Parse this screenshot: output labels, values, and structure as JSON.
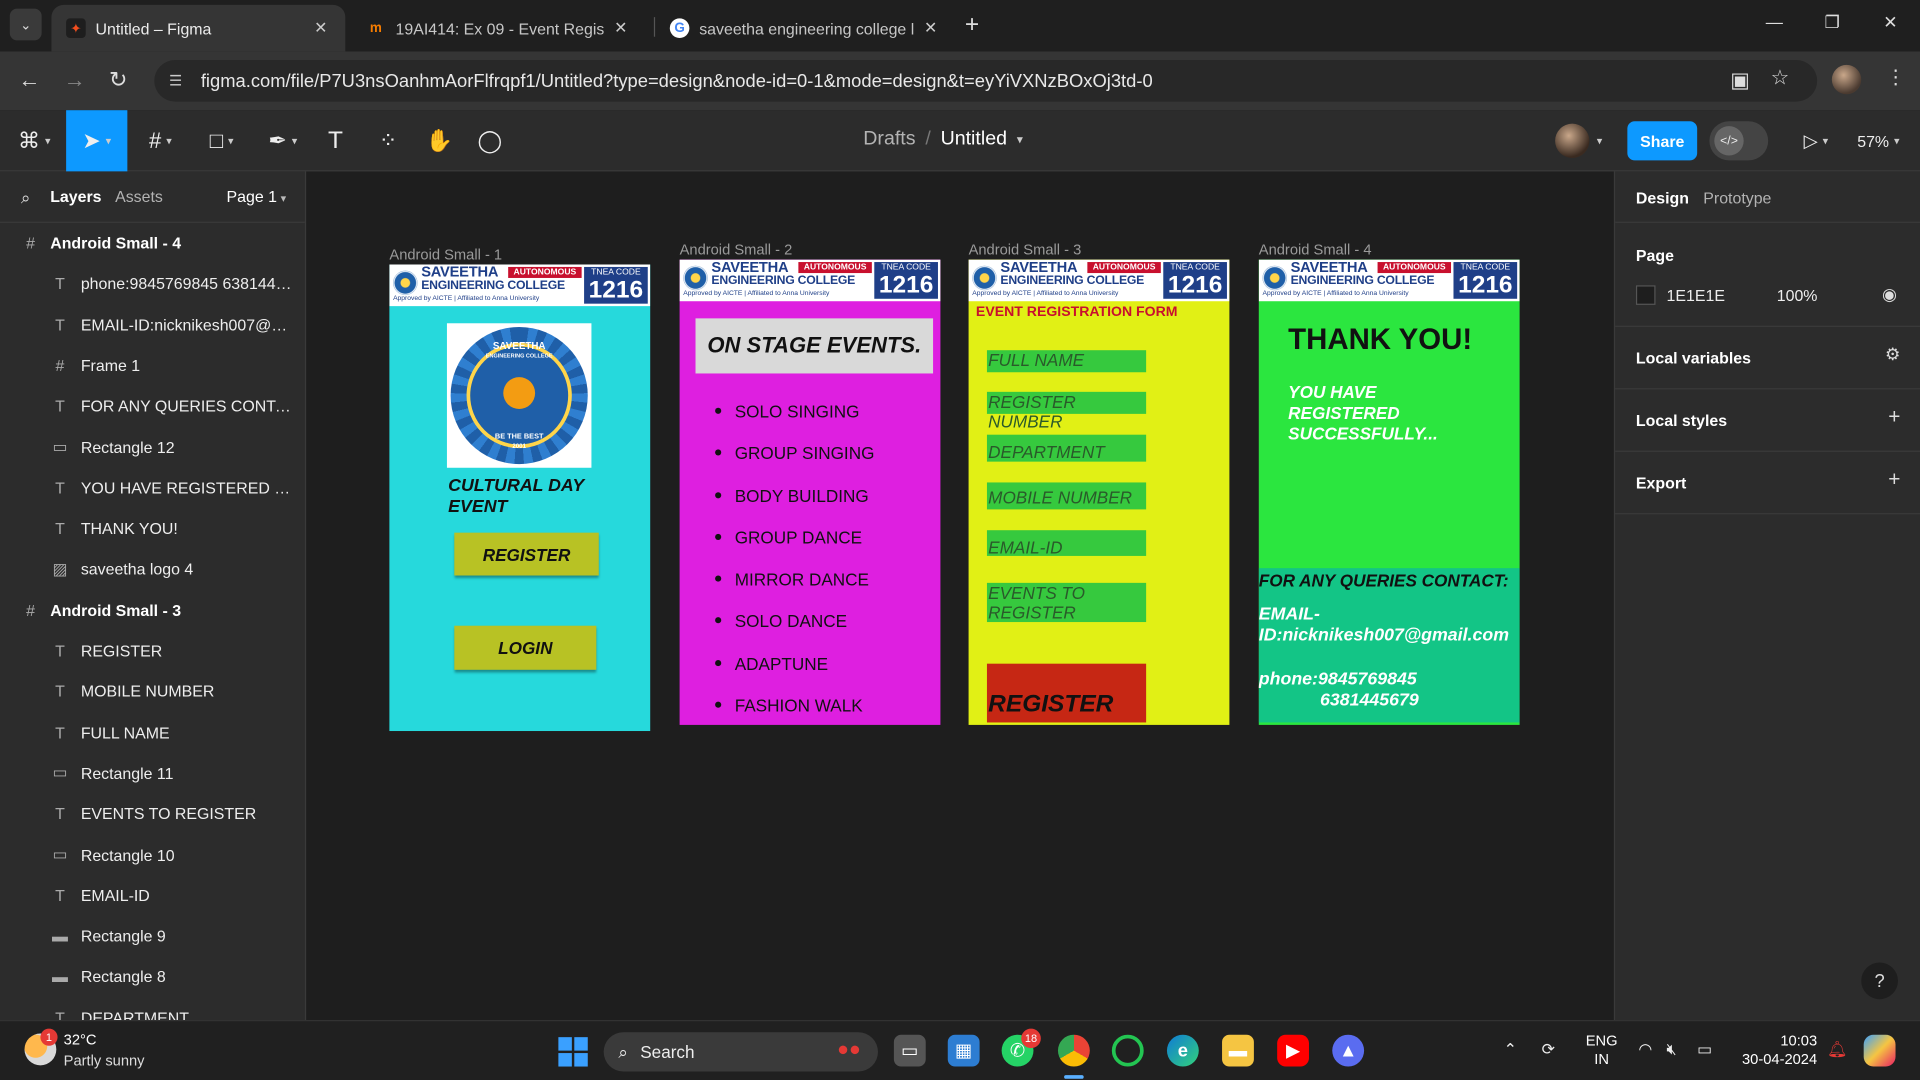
{
  "browser": {
    "tabs": [
      {
        "title": "Untitled – Figma",
        "active": true
      },
      {
        "title": "19AI414: Ex 09 - Event Registrat",
        "active": false
      },
      {
        "title": "saveetha engineering college lo",
        "active": false
      }
    ],
    "url": "figma.com/file/P7U3nsOanhmAorFlfrqpf1/Untitled?type=design&node-id=0-1&mode=design&t=eyYiVXNzBOxOj3td-0"
  },
  "figma": {
    "breadcrumb": {
      "folder": "Drafts",
      "file": "Untitled"
    },
    "share_label": "Share",
    "zoom": "57%",
    "left_panel": {
      "tab_layers": "Layers",
      "tab_assets": "Assets",
      "page": "Page 1",
      "layers": [
        {
          "name": "Android Small - 4",
          "type": "frame",
          "indent": 0
        },
        {
          "name": "phone:9845769845 6381445...",
          "type": "text",
          "indent": 1
        },
        {
          "name": "EMAIL-ID:nicknikesh007@gm...",
          "type": "text",
          "indent": 1
        },
        {
          "name": "Frame 1",
          "type": "frame-child",
          "indent": 1
        },
        {
          "name": "FOR ANY QUERIES CONTACT:",
          "type": "text",
          "indent": 1
        },
        {
          "name": "Rectangle 12",
          "type": "rect",
          "indent": 1
        },
        {
          "name": "YOU HAVE REGISTERED SUC...",
          "type": "text",
          "indent": 1
        },
        {
          "name": "THANK YOU!",
          "type": "text",
          "indent": 1
        },
        {
          "name": "saveetha logo 4",
          "type": "image",
          "indent": 1
        },
        {
          "name": "Android Small - 3",
          "type": "frame",
          "indent": 0
        },
        {
          "name": "REGISTER",
          "type": "text",
          "indent": 1
        },
        {
          "name": "MOBILE NUMBER",
          "type": "text",
          "indent": 1
        },
        {
          "name": "FULL NAME",
          "type": "text",
          "indent": 1
        },
        {
          "name": "Rectangle 11",
          "type": "rect-thin",
          "indent": 1
        },
        {
          "name": "EVENTS TO REGISTER",
          "type": "text",
          "indent": 1
        },
        {
          "name": "Rectangle 10",
          "type": "rect-thin",
          "indent": 1
        },
        {
          "name": "EMAIL-ID",
          "type": "text",
          "indent": 1
        },
        {
          "name": "Rectangle 9",
          "type": "line",
          "indent": 1
        },
        {
          "name": "Rectangle 8",
          "type": "line",
          "indent": 1
        },
        {
          "name": "DEPARTMENT",
          "type": "text",
          "indent": 1
        }
      ]
    },
    "right_panel": {
      "tab_design": "Design",
      "tab_prototype": "Prototype",
      "page_title": "Page",
      "page_color_hex": "1E1E1E",
      "page_opacity": "100%",
      "sections": [
        "Local variables",
        "Local styles",
        "Export"
      ]
    },
    "canvas": {
      "logo": {
        "name_line1": "SAVEETHA",
        "name_line2": "ENGINEERING COLLEGE",
        "autonomous": "AUTONOMOUS",
        "approved": "Approved by AICTE | Affiliated to Anna University",
        "code_title": "TNEA CODE",
        "code_number": "1216"
      },
      "frames": [
        {
          "label": "Android Small - 1",
          "bg": "#26d9dc",
          "emblem_top": "SAVEETHA",
          "emblem_sub": "ENGINEERING COLLEGE",
          "emblem_motto": "BE THE BEST",
          "emblem_year": "2001",
          "title": "CULTURAL DAY EVENT",
          "register": "REGISTER",
          "login": "LOGIN"
        },
        {
          "label": "Android Small - 2",
          "bg": "#de1fe0",
          "banner": "ON STAGE EVENTS.",
          "events": [
            "SOLO SINGING",
            "GROUP SINGING",
            "BODY BUILDING",
            "GROUP DANCE",
            "MIRROR DANCE",
            "SOLO DANCE",
            "ADAPTUNE",
            "FASHION WALK"
          ]
        },
        {
          "label": "Android Small - 3",
          "bg": "#e1f015",
          "form_title": "EVENT REGISTRATION FORM",
          "fields": [
            "FULL NAME",
            "REGISTER NUMBER",
            "DEPARTMENT",
            "MOBILE NUMBER",
            "EMAIL-ID",
            "EVENTS TO REGISTER"
          ],
          "register": "REGISTER"
        },
        {
          "label": "Android Small - 4",
          "bg": "#2be63f",
          "thank_you": "THANK YOU!",
          "message": "YOU HAVE REGISTERED SUCCESSFULLY...",
          "contact_title": "FOR ANY QUERIES CONTACT:",
          "email": "EMAIL-ID:nicknikesh007@gmail.com",
          "phone1": "phone:9845769845",
          "phone2": "6381445679"
        }
      ]
    }
  },
  "taskbar": {
    "weather_temp": "32°C",
    "weather_desc": "Partly sunny",
    "weather_badge": "1",
    "search_placeholder": "Search",
    "whatsapp_badge": "18",
    "lang_line1": "ENG",
    "lang_line2": "IN",
    "time": "10:03",
    "date": "30-04-2024"
  }
}
